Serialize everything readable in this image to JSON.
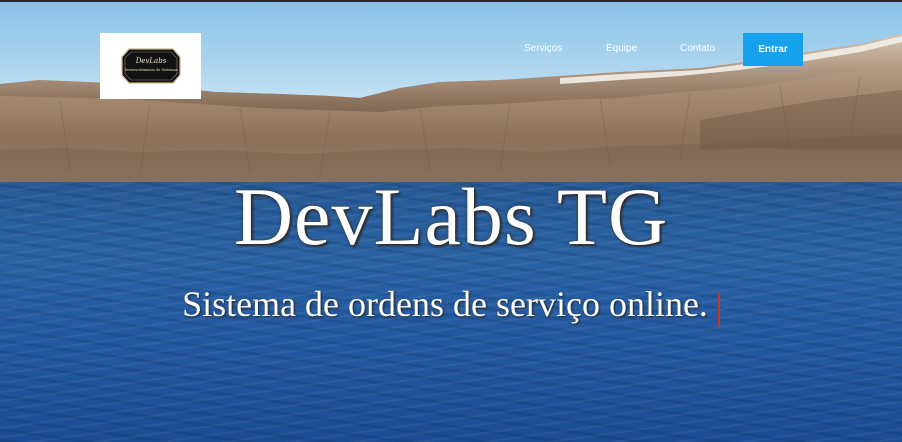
{
  "brand": {
    "logo_text": "DevLabs",
    "logo_subtext": "Desenvolvimento de Sistemas"
  },
  "nav": {
    "items": [
      {
        "label": "Serviços"
      },
      {
        "label": "Equipe"
      },
      {
        "label": "Contato"
      }
    ],
    "enter_label": "Entrar"
  },
  "hero": {
    "title": "DevLabs TG",
    "subtitle": "Sistema de ordens de serviço online."
  },
  "colors": {
    "accent": "#16a1ec",
    "caret": "#c0392b",
    "text": "#ffffff"
  }
}
